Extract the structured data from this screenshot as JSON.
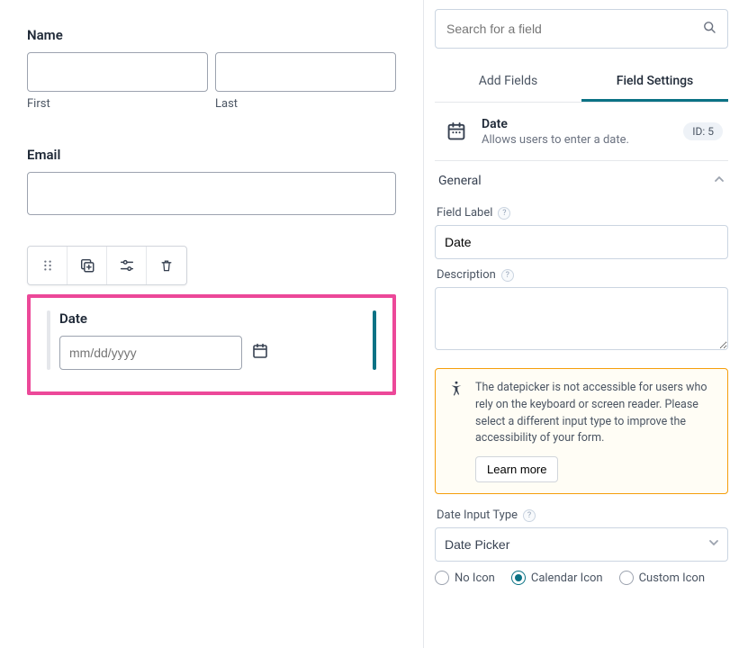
{
  "canvas": {
    "name": {
      "label": "Name",
      "first_sub": "First",
      "last_sub": "Last"
    },
    "email": {
      "label": "Email"
    },
    "date_field": {
      "label": "Date",
      "placeholder": "mm/dd/yyyy"
    }
  },
  "sidebar": {
    "search_placeholder": "Search for a field",
    "tabs": {
      "add": "Add Fields",
      "settings": "Field Settings"
    },
    "field_header": {
      "title": "Date",
      "desc": "Allows users to enter a date.",
      "id_badge": "ID: 5"
    },
    "section_general": "General",
    "labels": {
      "field_label": "Field Label",
      "description": "Description",
      "date_input_type": "Date Input Type"
    },
    "field_label_value": "Date",
    "description_value": "",
    "notice": {
      "text": "The datepicker is not accessible for users who rely on the keyboard or screen reader. Please select a different input type to improve the accessibility of your form.",
      "learn_more": "Learn more"
    },
    "date_input_type_value": "Date Picker",
    "icon_options": {
      "none": "No Icon",
      "calendar": "Calendar Icon",
      "custom": "Custom Icon",
      "selected": "calendar"
    }
  }
}
